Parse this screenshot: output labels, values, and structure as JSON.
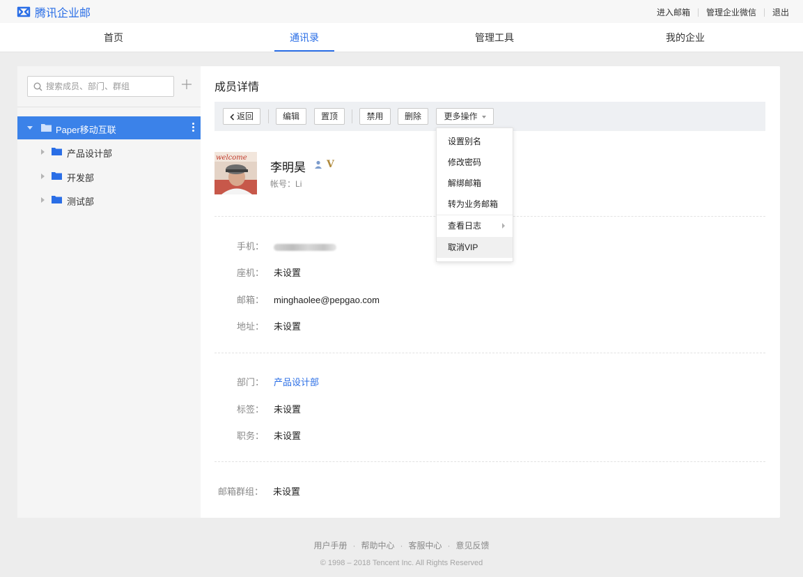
{
  "brand": {
    "name": "腾讯企业邮",
    "color": "#2a6ee6"
  },
  "top_links": [
    "进入邮箱",
    "管理企业微信",
    "退出"
  ],
  "nav": {
    "items": [
      "首页",
      "通讯录",
      "管理工具",
      "我的企业"
    ],
    "active": "通讯录"
  },
  "sidebar": {
    "search_placeholder": "搜索成员、部门、群组",
    "root": "Paper移动互联",
    "departments": [
      "产品设计部",
      "开发部",
      "测试部"
    ]
  },
  "main": {
    "title": "成员详情",
    "toolbar": {
      "back": "返回",
      "edit": "编辑",
      "pin": "置顶",
      "disable": "禁用",
      "delete": "删除",
      "more": "更多操作"
    },
    "more_menu": [
      "设置别名",
      "修改密码",
      "解绑邮箱",
      "转为业务邮箱",
      "查看日志",
      "取消VIP"
    ],
    "more_menu_hovered": "取消VIP",
    "member": {
      "name": "李明昊",
      "account_label": "帐号：",
      "account": "Li",
      "avatar_text": "welcome",
      "vip_badge": "V"
    },
    "contact": {
      "phone_label": "手机：",
      "landline_label": "座机：",
      "landline": "未设置",
      "email_label": "邮箱：",
      "email": "minghaolee@pepgao.com",
      "address_label": "地址：",
      "address": "未设置"
    },
    "org": {
      "dept_label": "部门：",
      "dept": "产品设计部",
      "tag_label": "标签：",
      "tag": "未设置",
      "position_label": "职务：",
      "position": "未设置"
    },
    "groups": {
      "label": "邮箱群组：",
      "value": "未设置"
    }
  },
  "footer": {
    "links": [
      "用户手册",
      "帮助中心",
      "客服中心",
      "意见反馈"
    ],
    "separator": "·",
    "copyright": "© 1998 – 2018 Tencent Inc. All Rights Reserved"
  }
}
